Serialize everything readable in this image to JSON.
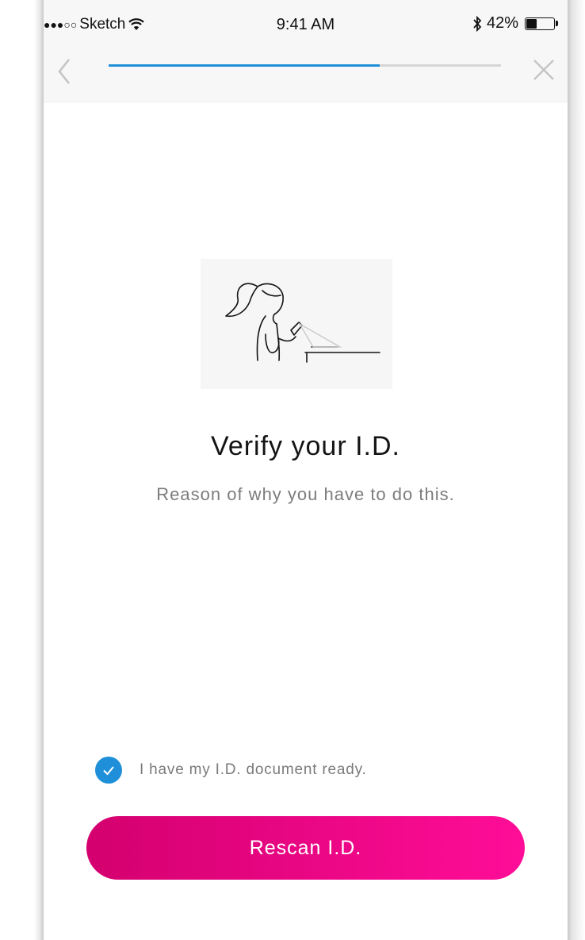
{
  "status_bar": {
    "signal_dots": "●●●○○",
    "carrier": "Sketch",
    "wifi_icon": "wifi-icon",
    "time": "9:41 AM",
    "bluetooth_icon": "bluetooth-icon",
    "battery_percent": "42%",
    "battery_level": 0.42
  },
  "nav": {
    "back_icon": "chevron-left-icon",
    "close_icon": "close-icon",
    "progress": 0.69,
    "colors": {
      "progress_fill": "#1e8fd8",
      "progress_track": "#d6d6d6"
    }
  },
  "content": {
    "illustration": "woman-scanning-id-illustration",
    "title": "Verify your I.D.",
    "subtitle": "Reason of why you have to do this."
  },
  "confirmation": {
    "checked": true,
    "label": "I have my I.D. document ready.",
    "color": "#1e8fd8"
  },
  "action": {
    "label": "Rescan I.D.",
    "gradient": [
      "#d4006f",
      "#ff0d98"
    ]
  }
}
